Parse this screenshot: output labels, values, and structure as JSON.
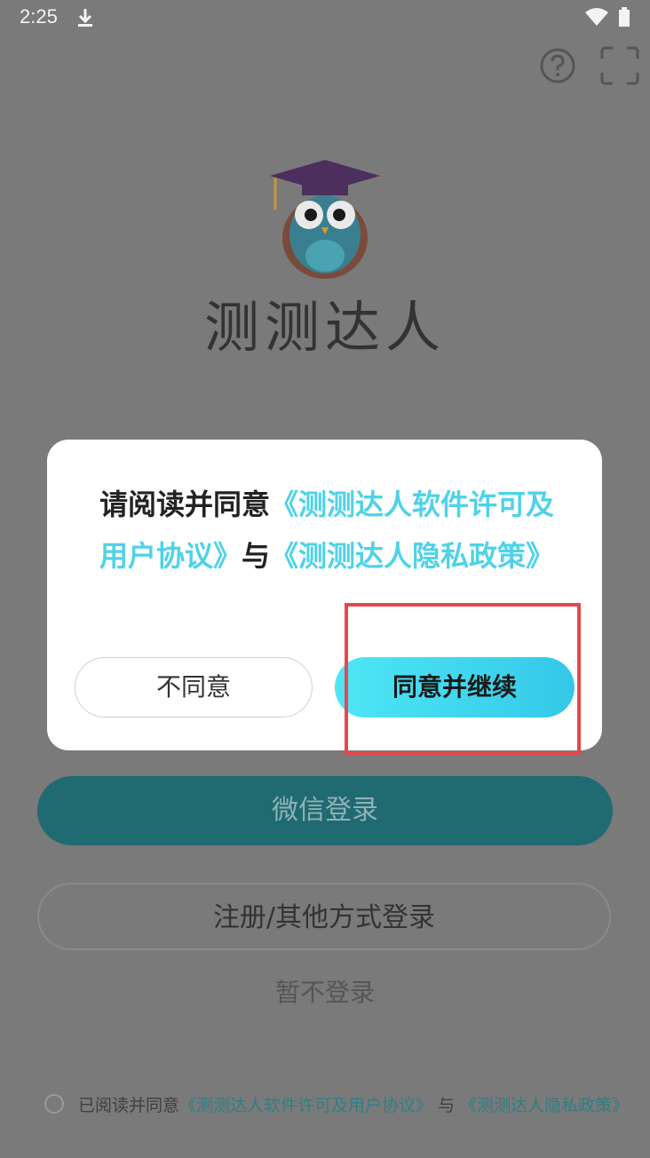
{
  "status_bar": {
    "time": "2:25"
  },
  "app": {
    "name": "测测达人"
  },
  "login": {
    "wechat_label": "微信登录",
    "other_label": "注册/其他方式登录",
    "skip_label": "暂不登录"
  },
  "agreement_row": {
    "prefix": "已阅读并同意",
    "license_link": "《测测达人软件许可及用户协议》",
    "joiner": "与",
    "privacy_link": "《测测达人隐私政策》"
  },
  "dialog": {
    "prefix": "请阅读并同意",
    "license_link": "《测测达人软件许可及用户协议》",
    "joiner": "与",
    "privacy_link": "《测测达人隐私政策》",
    "disagree_label": "不同意",
    "agree_label": "同意并继续"
  },
  "icons": {
    "download": "download-icon",
    "wifi": "wifi-icon",
    "battery": "battery-icon",
    "help": "help-icon",
    "scan": "scan-icon",
    "logo": "owl-logo"
  },
  "colors": {
    "accent": "#4fd2e8",
    "wechat_button": "#206a72",
    "highlight": "#e5484d"
  }
}
